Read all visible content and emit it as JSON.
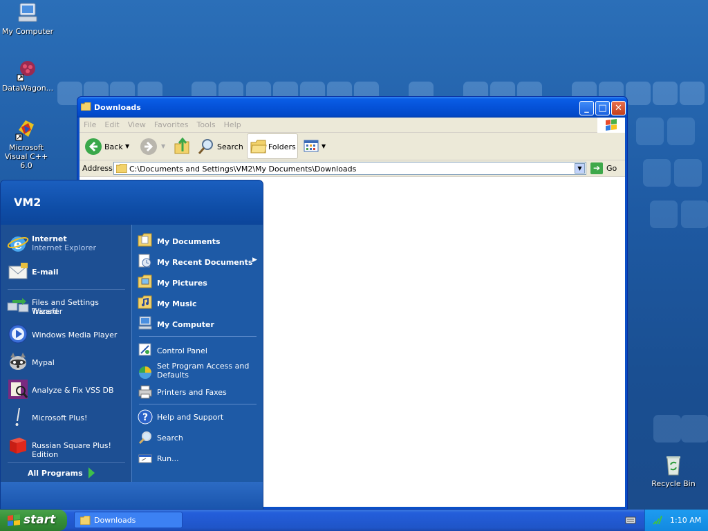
{
  "desktop": {
    "icons": [
      {
        "label": "My Computer"
      },
      {
        "label": "DataWagon..."
      },
      {
        "label": "Microsoft Visual C++ 6.0"
      },
      {
        "label": "Recycle Bin"
      }
    ]
  },
  "window": {
    "title": "Downloads",
    "menu": [
      "File",
      "Edit",
      "View",
      "Favorites",
      "Tools",
      "Help"
    ],
    "toolbar": {
      "back_label": "Back",
      "search_label": "Search",
      "folders_label": "Folders"
    },
    "address": {
      "label": "Address",
      "value": "C:\\Documents and Settings\\VM2\\My Documents\\Downloads",
      "go_label": "Go"
    }
  },
  "start_menu": {
    "user": "VM2",
    "left_items": [
      {
        "label": "Internet",
        "sub": "Internet Explorer"
      },
      {
        "label": "E-mail",
        "sub": ""
      },
      {
        "label": "Files and Settings Transfer",
        "sub": "Wizard"
      },
      {
        "label": "Windows Media Player"
      },
      {
        "label": "Mypal"
      },
      {
        "label": "Analyze & Fix VSS DB"
      },
      {
        "label": "Microsoft Plus!"
      },
      {
        "label": "Russian Square Plus! Edition"
      }
    ],
    "all_programs": "All Programs",
    "right_items": [
      {
        "label": "My Documents"
      },
      {
        "label": "My Recent Documents"
      },
      {
        "label": "My Pictures"
      },
      {
        "label": "My Music"
      },
      {
        "label": "My Computer"
      },
      {
        "label": "Control Panel"
      },
      {
        "label": "Set Program Access and",
        "sub": "Defaults"
      },
      {
        "label": "Printers and Faxes"
      },
      {
        "label": "Help and Support"
      },
      {
        "label": "Search"
      },
      {
        "label": "Run..."
      }
    ]
  },
  "taskbar": {
    "start_label": "start",
    "tasks": [
      {
        "label": "Downloads"
      }
    ],
    "clock": "1:10 AM"
  }
}
